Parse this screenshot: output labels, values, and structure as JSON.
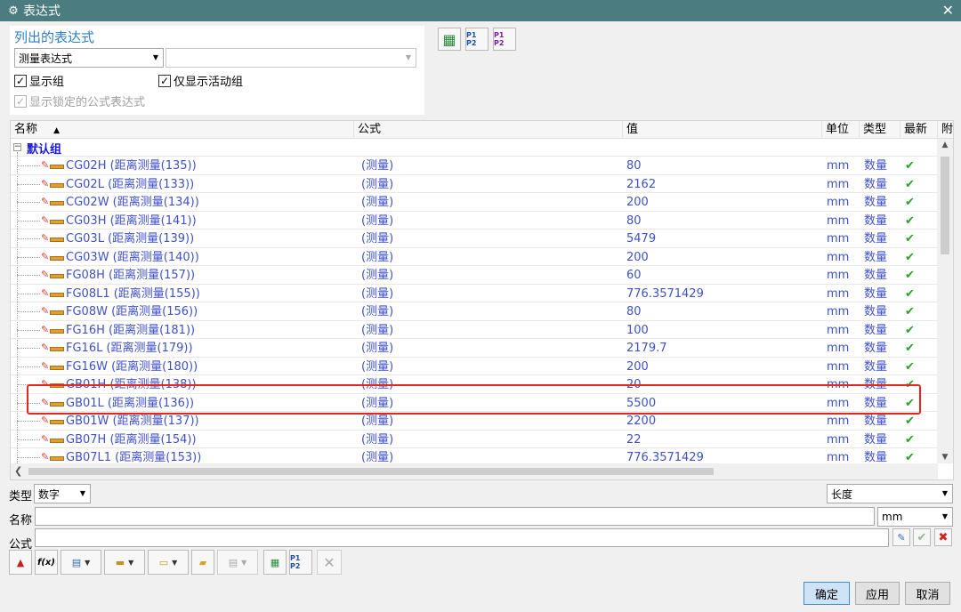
{
  "window": {
    "title": "表达式",
    "close_label": "✕"
  },
  "list_panel": {
    "heading": "列出的表达式",
    "filter_select": "测量表达式",
    "filter_input": "",
    "show_group": "显示组",
    "show_active_group": "仅显示活动组",
    "show_locked": "显示锁定的公式表达式"
  },
  "top_toolbar": {
    "btn1": "▦",
    "btn2": "P1 P2",
    "btn3": "P1 P2"
  },
  "grid": {
    "columns": [
      "名称",
      "公式",
      "值",
      "单位",
      "类型",
      "最新",
      "附"
    ],
    "sort_indicator": "▲",
    "group_name": "默认组",
    "group_toggle": "−",
    "rows": [
      {
        "name": "CG02H  (距离测量(135))",
        "formula": "(测量)",
        "value": "80",
        "unit": "mm",
        "type": "数量",
        "latest": "✔"
      },
      {
        "name": "CG02L  (距离测量(133))",
        "formula": "(测量)",
        "value": "2162",
        "unit": "mm",
        "type": "数量",
        "latest": "✔"
      },
      {
        "name": "CG02W  (距离测量(134))",
        "formula": "(测量)",
        "value": "200",
        "unit": "mm",
        "type": "数量",
        "latest": "✔"
      },
      {
        "name": "CG03H  (距离测量(141))",
        "formula": "(测量)",
        "value": "80",
        "unit": "mm",
        "type": "数量",
        "latest": "✔"
      },
      {
        "name": "CG03L  (距离测量(139))",
        "formula": "(测量)",
        "value": "5479",
        "unit": "mm",
        "type": "数量",
        "latest": "✔"
      },
      {
        "name": "CG03W  (距离测量(140))",
        "formula": "(测量)",
        "value": "200",
        "unit": "mm",
        "type": "数量",
        "latest": "✔"
      },
      {
        "name": "FG08H  (距离测量(157))",
        "formula": "(测量)",
        "value": "60",
        "unit": "mm",
        "type": "数量",
        "latest": "✔"
      },
      {
        "name": "FG08L1  (距离测量(155))",
        "formula": "(测量)",
        "value": "776.3571429",
        "unit": "mm",
        "type": "数量",
        "latest": "✔"
      },
      {
        "name": "FG08W  (距离测量(156))",
        "formula": "(测量)",
        "value": "80",
        "unit": "mm",
        "type": "数量",
        "latest": "✔"
      },
      {
        "name": "FG16H  (距离测量(181))",
        "formula": "(测量)",
        "value": "100",
        "unit": "mm",
        "type": "数量",
        "latest": "✔"
      },
      {
        "name": "FG16L  (距离测量(179))",
        "formula": "(测量)",
        "value": "2179.7",
        "unit": "mm",
        "type": "数量",
        "latest": "✔"
      },
      {
        "name": "FG16W  (距离测量(180))",
        "formula": "(测量)",
        "value": "200",
        "unit": "mm",
        "type": "数量",
        "latest": "✔"
      },
      {
        "name": "GB01H  (距离测量(138))",
        "formula": "(测量)",
        "value": "20",
        "unit": "mm",
        "type": "数量",
        "latest": "✔"
      },
      {
        "name": "GB01L  (距离测量(136))",
        "formula": "(测量)",
        "value": "5500",
        "unit": "mm",
        "type": "数量",
        "latest": "✔"
      },
      {
        "name": "GB01W  (距离测量(137))",
        "formula": "(测量)",
        "value": "2200",
        "unit": "mm",
        "type": "数量",
        "latest": "✔"
      },
      {
        "name": "GB07H  (距离测量(154))",
        "formula": "(测量)",
        "value": "22",
        "unit": "mm",
        "type": "数量",
        "latest": "✔"
      },
      {
        "name": "GB07L1  (距离测量(153))",
        "formula": "(测量)",
        "value": "776.3571429",
        "unit": "mm",
        "type": "数量",
        "latest": "✔"
      }
    ]
  },
  "editor": {
    "type_label": "类型",
    "type_value": "数字",
    "dimension_value": "长度",
    "name_label": "名称",
    "name_value": "",
    "unit_value": "mm",
    "formula_label": "公式",
    "formula_value": ""
  },
  "bottom_toolbar": {
    "fx": "f(x)"
  },
  "buttons": {
    "ok": "确定",
    "apply": "应用",
    "cancel": "取消"
  },
  "colors": {
    "titlebar": "#4b7c80",
    "highlight": "#e4271d",
    "link": "#3f51c8",
    "group": "#1a1adf"
  }
}
